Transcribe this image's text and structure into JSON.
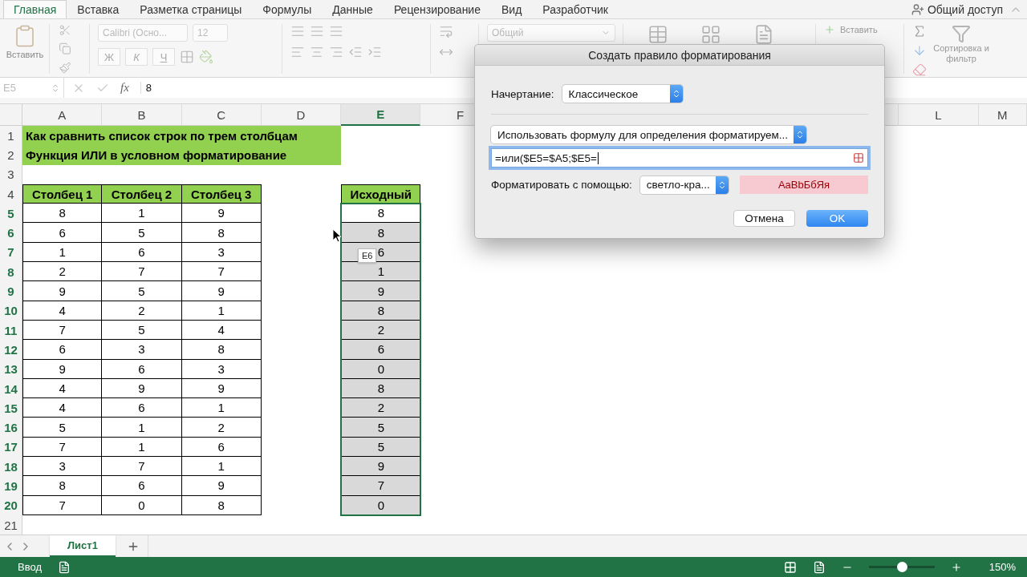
{
  "ribbon_tabs": [
    {
      "label": "Главная",
      "selected": true
    },
    {
      "label": "Вставка",
      "selected": false
    },
    {
      "label": "Разметка страницы",
      "selected": false
    },
    {
      "label": "Формулы",
      "selected": false
    },
    {
      "label": "Данные",
      "selected": false
    },
    {
      "label": "Рецензирование",
      "selected": false
    },
    {
      "label": "Вид",
      "selected": false
    },
    {
      "label": "Разработчик",
      "selected": false
    }
  ],
  "share_button": "Общий доступ",
  "toolbar": {
    "paste_label": "Вставить",
    "font_name": "Calibri (Осно...",
    "font_size": "12",
    "bold": "Ж",
    "italic": "К",
    "underline": "Ч",
    "number_format": "Общий",
    "insert_cells": "Вставить",
    "sort_filter": "Сортировка и фильтр"
  },
  "formula_bar": {
    "name_box": "E5",
    "function_label": "fx",
    "value": "8"
  },
  "columns": [
    {
      "label": "A",
      "selected": false
    },
    {
      "label": "B",
      "selected": false
    },
    {
      "label": "C",
      "selected": false
    },
    {
      "label": "D",
      "selected": false
    },
    {
      "label": "E",
      "selected": true
    },
    {
      "label": "F",
      "selected": false
    },
    {
      "label": "L",
      "selected": false
    },
    {
      "label": "M",
      "selected": false
    }
  ],
  "rows": [
    {
      "number": "1",
      "selected": false,
      "kind": "title",
      "text": "Как сравнить список строк по трем столбцам"
    },
    {
      "number": "2",
      "selected": false,
      "kind": "title",
      "text": "Функция ИЛИ в условном форматирование"
    },
    {
      "number": "3",
      "selected": false,
      "kind": "blank"
    },
    {
      "number": "4",
      "selected": false,
      "kind": "header",
      "cells": [
        "Столбец 1",
        "Столбец 2",
        "Столбец 3"
      ],
      "source": "Исходный"
    },
    {
      "number": "5",
      "selected": true,
      "kind": "data",
      "cells": [
        "8",
        "1",
        "9"
      ],
      "source": "8",
      "highlighted": false
    },
    {
      "number": "6",
      "selected": true,
      "kind": "data",
      "cells": [
        "6",
        "5",
        "8"
      ],
      "source": "8",
      "highlighted": true
    },
    {
      "number": "7",
      "selected": true,
      "kind": "data",
      "cells": [
        "1",
        "6",
        "3"
      ],
      "source": "6",
      "highlighted": true
    },
    {
      "number": "8",
      "selected": true,
      "kind": "data",
      "cells": [
        "2",
        "7",
        "7"
      ],
      "source": "1",
      "highlighted": true
    },
    {
      "number": "9",
      "selected": true,
      "kind": "data",
      "cells": [
        "9",
        "5",
        "9"
      ],
      "source": "9",
      "highlighted": true
    },
    {
      "number": "10",
      "selected": true,
      "kind": "data",
      "cells": [
        "4",
        "2",
        "1"
      ],
      "source": "8",
      "highlighted": true
    },
    {
      "number": "11",
      "selected": true,
      "kind": "data",
      "cells": [
        "7",
        "5",
        "4"
      ],
      "source": "2",
      "highlighted": true
    },
    {
      "number": "12",
      "selected": true,
      "kind": "data",
      "cells": [
        "6",
        "3",
        "8"
      ],
      "source": "6",
      "highlighted": true
    },
    {
      "number": "13",
      "selected": true,
      "kind": "data",
      "cells": [
        "9",
        "6",
        "3"
      ],
      "source": "0",
      "highlighted": true
    },
    {
      "number": "14",
      "selected": true,
      "kind": "data",
      "cells": [
        "4",
        "9",
        "9"
      ],
      "source": "8",
      "highlighted": true
    },
    {
      "number": "15",
      "selected": true,
      "kind": "data",
      "cells": [
        "4",
        "6",
        "1"
      ],
      "source": "2",
      "highlighted": true
    },
    {
      "number": "16",
      "selected": true,
      "kind": "data",
      "cells": [
        "5",
        "1",
        "2"
      ],
      "source": "5",
      "highlighted": true
    },
    {
      "number": "17",
      "selected": true,
      "kind": "data",
      "cells": [
        "7",
        "1",
        "6"
      ],
      "source": "5",
      "highlighted": true
    },
    {
      "number": "18",
      "selected": true,
      "kind": "data",
      "cells": [
        "3",
        "7",
        "1"
      ],
      "source": "9",
      "highlighted": true
    },
    {
      "number": "19",
      "selected": true,
      "kind": "data",
      "cells": [
        "8",
        "6",
        "9"
      ],
      "source": "7",
      "highlighted": true
    },
    {
      "number": "20",
      "selected": true,
      "kind": "data",
      "cells": [
        "7",
        "0",
        "8"
      ],
      "source": "0",
      "highlighted": true
    },
    {
      "number": "21",
      "selected": false,
      "kind": "blank"
    }
  ],
  "drag_tooltip": "E6",
  "dialog": {
    "title": "Создать правило форматирования",
    "style_label": "Начертание:",
    "style_value": "Классическое",
    "rule_type": "Использовать формулу для определения форматируем...",
    "formula": "=или($E5=$A5;$E5=",
    "format_label": "Форматировать с помощью:",
    "format_value": "светло-кра...",
    "preview": "AaBbБбЯя",
    "buttons": [
      {
        "label": "Отмена",
        "primary": false
      },
      {
        "label": "OK",
        "primary": true
      }
    ]
  },
  "sheets": [
    {
      "label": "Лист1",
      "selected": true
    }
  ],
  "status_bar": {
    "mode": "Ввод",
    "zoom": {
      "level": 0.5,
      "reading": "150%"
    }
  }
}
